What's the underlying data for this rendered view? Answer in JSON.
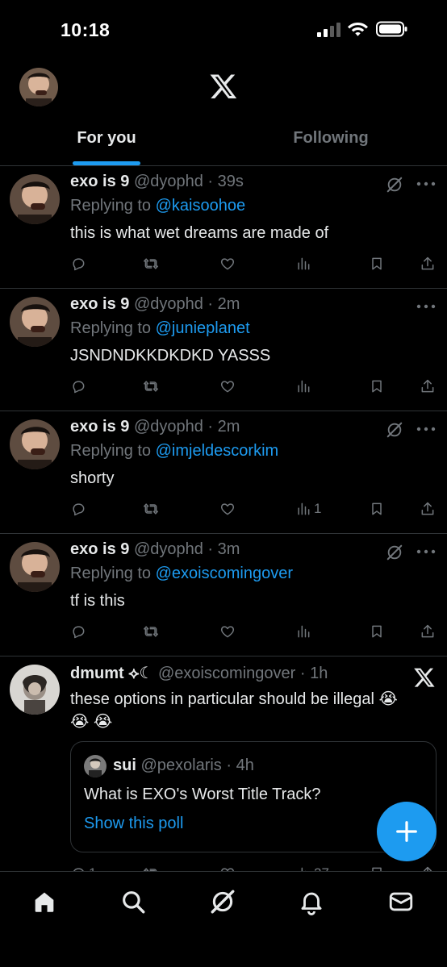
{
  "status_bar": {
    "time": "10:18"
  },
  "header": {
    "tabs": [
      {
        "label": "For you",
        "active": true
      },
      {
        "label": "Following",
        "active": false
      }
    ]
  },
  "tweets": [
    {
      "display_name": "exo is 9",
      "handle": "@dyophd",
      "time": "39s",
      "replying_prefix": "Replying to ",
      "replying_to": "@kaisoohoe",
      "text": "this is what wet dreams are made of",
      "grok_icon": true,
      "views": ""
    },
    {
      "display_name": "exo is 9",
      "handle": "@dyophd",
      "time": "2m",
      "replying_prefix": "Replying to ",
      "replying_to": "@junieplanet",
      "text": "JSNDNDKKDKDKD YASSS",
      "grok_icon": false,
      "views": ""
    },
    {
      "display_name": "exo is 9",
      "handle": "@dyophd",
      "time": "2m",
      "replying_prefix": "Replying to ",
      "replying_to": "@imjeldescorkim",
      "text": "shorty",
      "grok_icon": true,
      "views": "1"
    },
    {
      "display_name": "exo is 9",
      "handle": "@dyophd",
      "time": "3m",
      "replying_prefix": "Replying to ",
      "replying_to": "@exoiscomingover",
      "text": "tf is this",
      "grok_icon": true,
      "views": ""
    }
  ],
  "quote_tweet": {
    "display_name": "dmumt ⟡☾",
    "handle": "@exoiscomingover",
    "time": "1h",
    "text_line1": "these options in particular should be illegal 😭",
    "text_line2": "😭 😭",
    "quoted": {
      "display_name": "sui",
      "handle": "@pexolaris",
      "time": "4h",
      "text": "What is EXO's Worst Title Track?",
      "poll_link": "Show this poll"
    },
    "replies": "1",
    "views": "27"
  },
  "colors": {
    "accent": "#1d9bf0",
    "muted": "#71767b",
    "text": "#e7e9ea",
    "background": "#000000",
    "border": "#2f3336"
  },
  "icons": [
    "grok-icon",
    "more-icon",
    "reply-icon",
    "retweet-icon",
    "like-icon",
    "views-icon",
    "bookmark-icon",
    "share-icon",
    "home-icon",
    "search-icon",
    "notifications-icon",
    "messages-icon",
    "compose-icon",
    "x-logo-icon"
  ]
}
